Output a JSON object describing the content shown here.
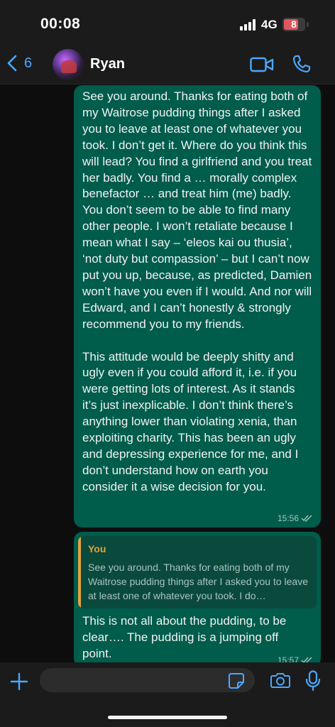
{
  "status_bar": {
    "time": "00:08",
    "network": "4G",
    "battery": "8"
  },
  "header": {
    "back_count": "6",
    "contact_name": "Ryan"
  },
  "messages": [
    {
      "text": "See you around. Thanks for eating both of my Waitrose pudding things after I asked you to leave at least one of whatever you took. I don’t get it. Where do you think this will lead? You find a girlfriend and you treat her badly. You find a … morally complex benefactor … and treat him (me) badly. You don’t seem to be able to find many other people. I won’t retaliate because I mean what I say – ‘eleos kai ou thusia’, ‘not duty but compassion’ – but I can’t now put you up, because, as predicted, Damien won’t have you even if I would. And nor will Edward, and I can’t honestly & strongly recommend you to my friends.\n\nThis attitude would be deeply shitty and ugly even if you could afford it, i.e. if you were getting lots of interest. As it stands it’s just inexplicable. I don’t think there’s anything lower than violating xenia, than exploiting charity. This has been an ugly and depressing experience for me, and I don’t understand how on earth you consider it a wise decision for you.",
      "time": "15:56"
    },
    {
      "quote_author": "You",
      "quote_text": "See you around. Thanks for eating both of my Waitrose pudding things after I asked you to leave at least one of whatever you took. I do…",
      "text": "This is not all about the pudding, to be clear…. The pudding is a jumping off point.",
      "time": "15:57"
    }
  ],
  "composer": {
    "placeholder": ""
  },
  "colors": {
    "accent": "#4aa8ff",
    "bubble_outgoing": "#005c4b",
    "quote_author": "#e5a33b",
    "battery_low": "#e05660"
  },
  "icons": [
    "chevron-left-icon",
    "video-call-icon",
    "phone-icon",
    "plus-icon",
    "sticker-icon",
    "camera-icon",
    "microphone-icon",
    "double-check-icon"
  ]
}
